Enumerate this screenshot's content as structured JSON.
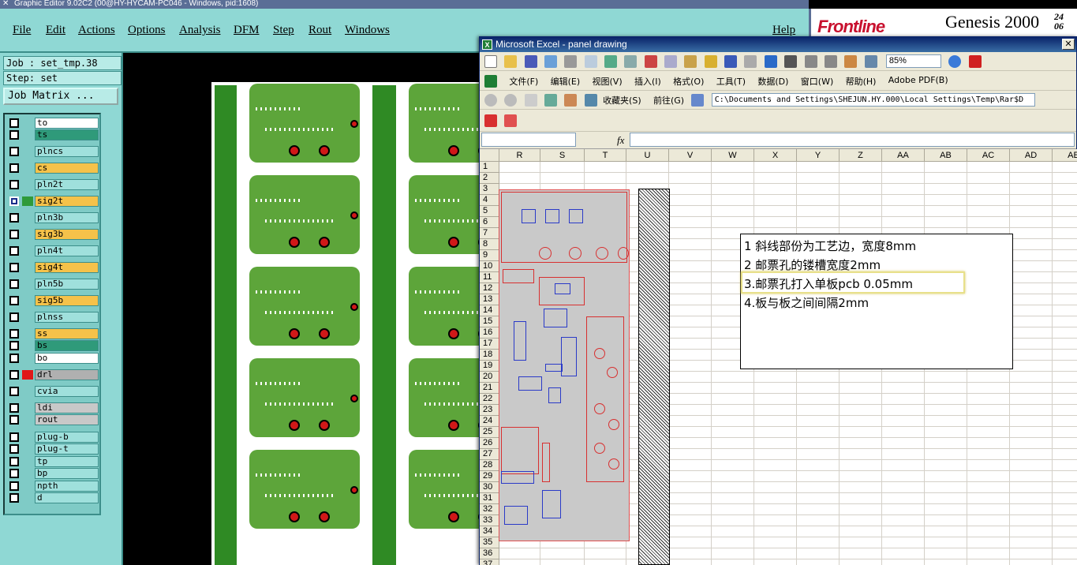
{
  "genesis": {
    "title": "Graphic Editor 9.02C2 (00@HY-HYCAM-PC046 - Windows, pid:1608)",
    "menu": [
      "File",
      "Edit",
      "Actions",
      "Options",
      "Analysis",
      "DFM",
      "Step",
      "Rout",
      "Windows"
    ],
    "help": "Help",
    "brand": "Frontline",
    "product": "Genesis 2000",
    "date_top": "24",
    "date_bottom": "06",
    "job": "Job : set_tmp.38",
    "step": "Step: set",
    "job_matrix": "Job Matrix ...",
    "layers": [
      {
        "name": "to",
        "color": "#ffffff",
        "swatch": ""
      },
      {
        "name": "ts",
        "color": "#2f9a7a",
        "swatch": ""
      },
      {
        "name": "plncs",
        "color": "#9fe0dc",
        "swatch": ""
      },
      {
        "name": "cs",
        "color": "#f5c24a",
        "swatch": ""
      },
      {
        "name": "pln2t",
        "color": "#9fe0dc",
        "swatch": ""
      },
      {
        "name": "sig2t",
        "color": "#f5c24a",
        "swatch": "#2f9a3a",
        "active": true
      },
      {
        "name": "pln3b",
        "color": "#9fe0dc",
        "swatch": ""
      },
      {
        "name": "sig3b",
        "color": "#f5c24a",
        "swatch": ""
      },
      {
        "name": "pln4t",
        "color": "#9fe0dc",
        "swatch": ""
      },
      {
        "name": "sig4t",
        "color": "#f5c24a",
        "swatch": ""
      },
      {
        "name": "pln5b",
        "color": "#9fe0dc",
        "swatch": ""
      },
      {
        "name": "sig5b",
        "color": "#f5c24a",
        "swatch": ""
      },
      {
        "name": "plnss",
        "color": "#9fe0dc",
        "swatch": ""
      },
      {
        "name": "ss",
        "color": "#f5c24a",
        "swatch": ""
      },
      {
        "name": "bs",
        "color": "#2f9a7a",
        "swatch": ""
      },
      {
        "name": "bo",
        "color": "#ffffff",
        "swatch": ""
      },
      {
        "name": "drl",
        "color": "#b0b0b0",
        "swatch": "#e01818"
      },
      {
        "name": "cvia",
        "color": "#9fe0dc",
        "swatch": ""
      },
      {
        "name": "ldi",
        "color": "#c8c8c8",
        "swatch": ""
      },
      {
        "name": "rout",
        "color": "#c8c8c8",
        "swatch": ""
      },
      {
        "name": "plug-b",
        "color": "#9fe0dc",
        "swatch": ""
      },
      {
        "name": "plug-t",
        "color": "#9fe0dc",
        "swatch": ""
      },
      {
        "name": "tp",
        "color": "#9fe0dc",
        "swatch": ""
      },
      {
        "name": "bp",
        "color": "#9fe0dc",
        "swatch": ""
      },
      {
        "name": "npth",
        "color": "#9fe0dc",
        "swatch": ""
      },
      {
        "name": "d",
        "color": "#9fe0dc",
        "swatch": ""
      }
    ]
  },
  "excel": {
    "title": "Microsoft Excel - panel drawing",
    "menu": [
      "文件(F)",
      "编辑(E)",
      "视图(V)",
      "插入(I)",
      "格式(O)",
      "工具(T)",
      "数据(D)",
      "窗口(W)",
      "帮助(H)",
      "Adobe PDF(B)"
    ],
    "zoom": "85%",
    "favorites": "收藏夹(S)",
    "go": "前往(G)",
    "address": "C:\\Documents and Settings\\SHEJUN.HY.000\\Local Settings\\Temp\\Rar$D",
    "fx": "fx",
    "columns": [
      "R",
      "S",
      "T",
      "U",
      "V",
      "W",
      "X",
      "Y",
      "Z",
      "AA",
      "AB",
      "AC",
      "AD",
      "AE"
    ],
    "rows": [
      "1",
      "2",
      "3",
      "4",
      "5",
      "6",
      "7",
      "8",
      "9",
      "10",
      "11",
      "12",
      "13",
      "14",
      "15",
      "16",
      "17",
      "18",
      "19",
      "20",
      "21",
      "22",
      "23",
      "24",
      "25",
      "26",
      "27",
      "28",
      "29",
      "30",
      "31",
      "32",
      "33",
      "34",
      "35",
      "36",
      "37"
    ],
    "notes": [
      "1 斜线部份为工艺边，宽度8mm",
      "2 邮票孔的镂槽宽度2mm",
      "3.邮票孔打入单板pcb 0.05mm",
      "4.板与板之间间隔2mm"
    ]
  }
}
